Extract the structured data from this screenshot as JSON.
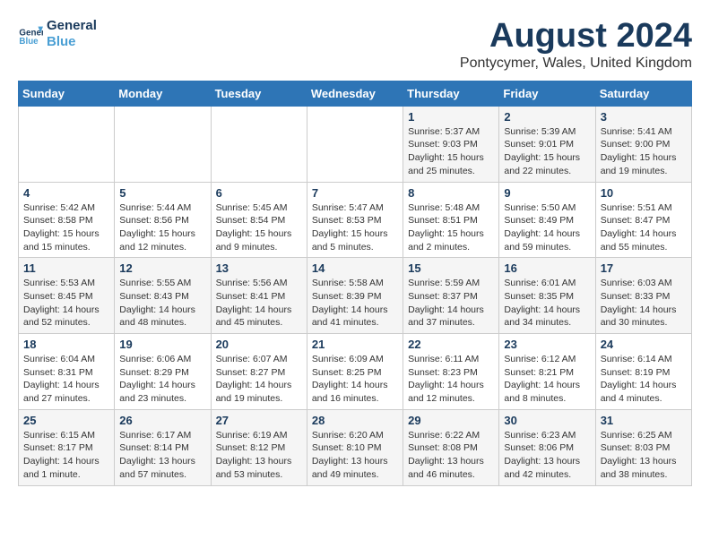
{
  "header": {
    "logo_line1": "General",
    "logo_line2": "Blue",
    "month_title": "August 2024",
    "location": "Pontycymer, Wales, United Kingdom"
  },
  "calendar": {
    "weekdays": [
      "Sunday",
      "Monday",
      "Tuesday",
      "Wednesday",
      "Thursday",
      "Friday",
      "Saturday"
    ],
    "weeks": [
      [
        {
          "day": "",
          "info": ""
        },
        {
          "day": "",
          "info": ""
        },
        {
          "day": "",
          "info": ""
        },
        {
          "day": "",
          "info": ""
        },
        {
          "day": "1",
          "info": "Sunrise: 5:37 AM\nSunset: 9:03 PM\nDaylight: 15 hours and 25 minutes."
        },
        {
          "day": "2",
          "info": "Sunrise: 5:39 AM\nSunset: 9:01 PM\nDaylight: 15 hours and 22 minutes."
        },
        {
          "day": "3",
          "info": "Sunrise: 5:41 AM\nSunset: 9:00 PM\nDaylight: 15 hours and 19 minutes."
        }
      ],
      [
        {
          "day": "4",
          "info": "Sunrise: 5:42 AM\nSunset: 8:58 PM\nDaylight: 15 hours and 15 minutes."
        },
        {
          "day": "5",
          "info": "Sunrise: 5:44 AM\nSunset: 8:56 PM\nDaylight: 15 hours and 12 minutes."
        },
        {
          "day": "6",
          "info": "Sunrise: 5:45 AM\nSunset: 8:54 PM\nDaylight: 15 hours and 9 minutes."
        },
        {
          "day": "7",
          "info": "Sunrise: 5:47 AM\nSunset: 8:53 PM\nDaylight: 15 hours and 5 minutes."
        },
        {
          "day": "8",
          "info": "Sunrise: 5:48 AM\nSunset: 8:51 PM\nDaylight: 15 hours and 2 minutes."
        },
        {
          "day": "9",
          "info": "Sunrise: 5:50 AM\nSunset: 8:49 PM\nDaylight: 14 hours and 59 minutes."
        },
        {
          "day": "10",
          "info": "Sunrise: 5:51 AM\nSunset: 8:47 PM\nDaylight: 14 hours and 55 minutes."
        }
      ],
      [
        {
          "day": "11",
          "info": "Sunrise: 5:53 AM\nSunset: 8:45 PM\nDaylight: 14 hours and 52 minutes."
        },
        {
          "day": "12",
          "info": "Sunrise: 5:55 AM\nSunset: 8:43 PM\nDaylight: 14 hours and 48 minutes."
        },
        {
          "day": "13",
          "info": "Sunrise: 5:56 AM\nSunset: 8:41 PM\nDaylight: 14 hours and 45 minutes."
        },
        {
          "day": "14",
          "info": "Sunrise: 5:58 AM\nSunset: 8:39 PM\nDaylight: 14 hours and 41 minutes."
        },
        {
          "day": "15",
          "info": "Sunrise: 5:59 AM\nSunset: 8:37 PM\nDaylight: 14 hours and 37 minutes."
        },
        {
          "day": "16",
          "info": "Sunrise: 6:01 AM\nSunset: 8:35 PM\nDaylight: 14 hours and 34 minutes."
        },
        {
          "day": "17",
          "info": "Sunrise: 6:03 AM\nSunset: 8:33 PM\nDaylight: 14 hours and 30 minutes."
        }
      ],
      [
        {
          "day": "18",
          "info": "Sunrise: 6:04 AM\nSunset: 8:31 PM\nDaylight: 14 hours and 27 minutes."
        },
        {
          "day": "19",
          "info": "Sunrise: 6:06 AM\nSunset: 8:29 PM\nDaylight: 14 hours and 23 minutes."
        },
        {
          "day": "20",
          "info": "Sunrise: 6:07 AM\nSunset: 8:27 PM\nDaylight: 14 hours and 19 minutes."
        },
        {
          "day": "21",
          "info": "Sunrise: 6:09 AM\nSunset: 8:25 PM\nDaylight: 14 hours and 16 minutes."
        },
        {
          "day": "22",
          "info": "Sunrise: 6:11 AM\nSunset: 8:23 PM\nDaylight: 14 hours and 12 minutes."
        },
        {
          "day": "23",
          "info": "Sunrise: 6:12 AM\nSunset: 8:21 PM\nDaylight: 14 hours and 8 minutes."
        },
        {
          "day": "24",
          "info": "Sunrise: 6:14 AM\nSunset: 8:19 PM\nDaylight: 14 hours and 4 minutes."
        }
      ],
      [
        {
          "day": "25",
          "info": "Sunrise: 6:15 AM\nSunset: 8:17 PM\nDaylight: 14 hours and 1 minute."
        },
        {
          "day": "26",
          "info": "Sunrise: 6:17 AM\nSunset: 8:14 PM\nDaylight: 13 hours and 57 minutes."
        },
        {
          "day": "27",
          "info": "Sunrise: 6:19 AM\nSunset: 8:12 PM\nDaylight: 13 hours and 53 minutes."
        },
        {
          "day": "28",
          "info": "Sunrise: 6:20 AM\nSunset: 8:10 PM\nDaylight: 13 hours and 49 minutes."
        },
        {
          "day": "29",
          "info": "Sunrise: 6:22 AM\nSunset: 8:08 PM\nDaylight: 13 hours and 46 minutes."
        },
        {
          "day": "30",
          "info": "Sunrise: 6:23 AM\nSunset: 8:06 PM\nDaylight: 13 hours and 42 minutes."
        },
        {
          "day": "31",
          "info": "Sunrise: 6:25 AM\nSunset: 8:03 PM\nDaylight: 13 hours and 38 minutes."
        }
      ]
    ]
  }
}
